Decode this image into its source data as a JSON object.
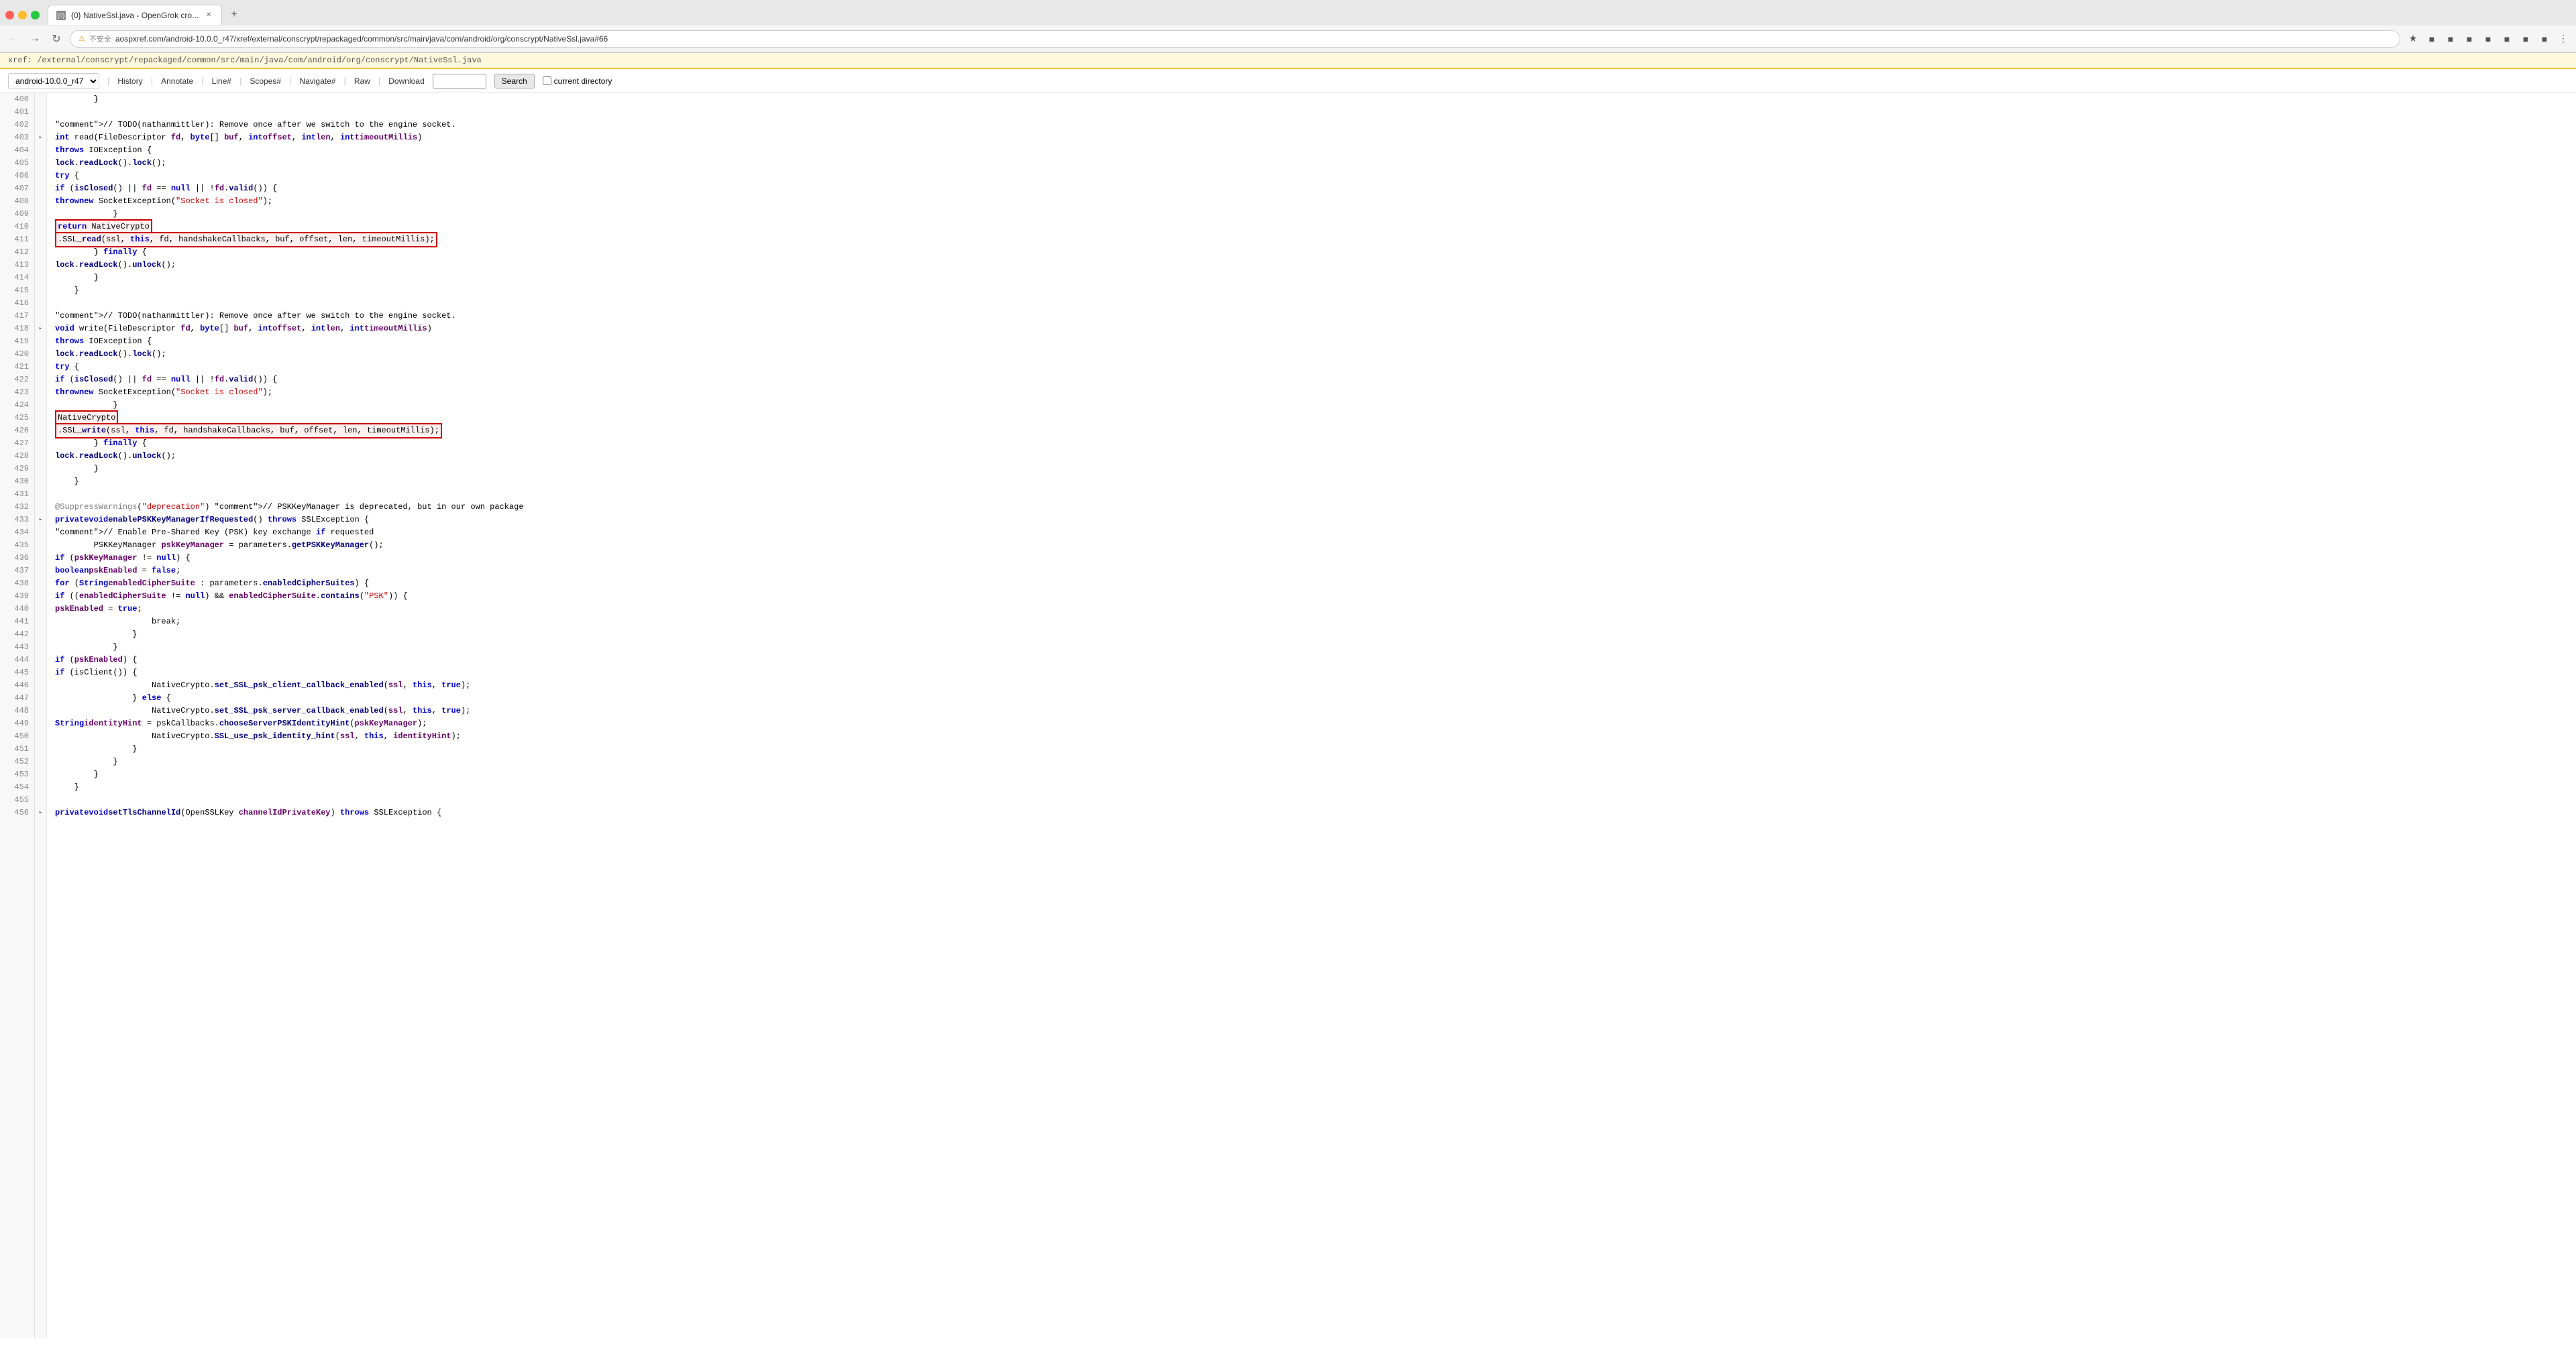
{
  "browser": {
    "tab_title": "{0} NativeSsl.java - OpenGrok cro...",
    "url": "aospxref.com/android-10.0.0_r47/xref/external/conscrypt/repackaged/common/src/main/java/com/android/org/conscrypt/NativeSsl.java#66",
    "full_url_prefix": "aospxref.com/android-10.0.0_r47/xref/external/conscrypt/repackaged/common/src/main/java/com/android/org/conscrypt/NativeSsl.java#66"
  },
  "breadcrumb": "xref: /external/conscrypt/repackaged/common/src/main/java/com/android/org/conscrypt/NativeSsl.java",
  "toolbar": {
    "version": "android-10.0.0_r47",
    "links": [
      "History",
      "Annotate",
      "Line#",
      "Scopes#",
      "Navigate#",
      "Raw",
      "Download"
    ],
    "search_placeholder": "",
    "search_btn": "Search",
    "checkbox_label": "current directory"
  },
  "code": {
    "lines": [
      {
        "num": "400",
        "fold": "",
        "content": "        }"
      },
      {
        "num": "401",
        "fold": "",
        "content": ""
      },
      {
        "num": "402",
        "fold": "",
        "content": "        // TODO(nathanmittler): Remove once after we switch to the engine socket."
      },
      {
        "num": "403",
        "fold": "▸",
        "content": "    int read(FileDescriptor fd, byte[] buf, int offset, int len, int timeoutMillis)"
      },
      {
        "num": "404",
        "fold": "",
        "content": "            throws IOException {"
      },
      {
        "num": "405",
        "fold": "",
        "content": "        lock.readLock().lock();"
      },
      {
        "num": "406",
        "fold": "",
        "content": "        try {"
      },
      {
        "num": "407",
        "fold": "",
        "content": "            if (isClosed() || fd == null || !fd.valid()) {"
      },
      {
        "num": "408",
        "fold": "",
        "content": "                throw new SocketException(\"Socket is closed\");"
      },
      {
        "num": "409",
        "fold": "",
        "content": "            }"
      },
      {
        "num": "410",
        "fold": "",
        "content": "            return NativeCrypto",
        "highlight_start": true
      },
      {
        "num": "411",
        "fold": "",
        "content": "                    .SSL_read(ssl, this, fd, handshakeCallbacks, buf, offset, len, timeoutMillis);",
        "highlight_end": true
      },
      {
        "num": "412",
        "fold": "",
        "content": "        } finally {"
      },
      {
        "num": "413",
        "fold": "",
        "content": "            lock.readLock().unlock();"
      },
      {
        "num": "414",
        "fold": "",
        "content": "        }"
      },
      {
        "num": "415",
        "fold": "",
        "content": "    }"
      },
      {
        "num": "416",
        "fold": "",
        "content": ""
      },
      {
        "num": "417",
        "fold": "",
        "content": "        // TODO(nathanmittler): Remove once after we switch to the engine socket."
      },
      {
        "num": "418",
        "fold": "▸",
        "content": "    void write(FileDescriptor fd, byte[] buf, int offset, int len, int timeoutMillis)"
      },
      {
        "num": "419",
        "fold": "",
        "content": "            throws IOException {"
      },
      {
        "num": "420",
        "fold": "",
        "content": "        lock.readLock().lock();"
      },
      {
        "num": "421",
        "fold": "",
        "content": "        try {"
      },
      {
        "num": "422",
        "fold": "",
        "content": "            if (isClosed() || fd == null || !fd.valid()) {"
      },
      {
        "num": "423",
        "fold": "",
        "content": "                throw new SocketException(\"Socket is closed\");"
      },
      {
        "num": "424",
        "fold": "",
        "content": "            }"
      },
      {
        "num": "425",
        "fold": "",
        "content": "            NativeCrypto",
        "highlight_start2": true
      },
      {
        "num": "426",
        "fold": "",
        "content": "                    .SSL_write(ssl, this, fd, handshakeCallbacks, buf, offset, len, timeoutMillis);",
        "highlight_end2": true
      },
      {
        "num": "427",
        "fold": "",
        "content": "        } finally {"
      },
      {
        "num": "428",
        "fold": "",
        "content": "            lock.readLock().unlock();"
      },
      {
        "num": "429",
        "fold": "",
        "content": "        }"
      },
      {
        "num": "430",
        "fold": "",
        "content": "    }"
      },
      {
        "num": "431",
        "fold": "",
        "content": ""
      },
      {
        "num": "432",
        "fold": "",
        "content": "    @SuppressWarnings(\"deprecation\") // PSKKeyManager is deprecated, but in our own package"
      },
      {
        "num": "433",
        "fold": "▸",
        "content": "    private void enablePSKKeyManagerIfRequested() throws SSLException {"
      },
      {
        "num": "434",
        "fold": "",
        "content": "        // Enable Pre-Shared Key (PSK) key exchange if requested"
      },
      {
        "num": "435",
        "fold": "",
        "content": "        PSKKeyManager pskKeyManager = parameters.getPSKKeyManager();"
      },
      {
        "num": "436",
        "fold": "",
        "content": "        if (pskKeyManager != null) {"
      },
      {
        "num": "437",
        "fold": "",
        "content": "            boolean pskEnabled = false;"
      },
      {
        "num": "438",
        "fold": "",
        "content": "            for (String enabledCipherSuite : parameters.enabledCipherSuites) {"
      },
      {
        "num": "439",
        "fold": "",
        "content": "                if ((enabledCipherSuite != null) && enabledCipherSuite.contains(\"PSK\")) {"
      },
      {
        "num": "440",
        "fold": "",
        "content": "                    pskEnabled = true;"
      },
      {
        "num": "441",
        "fold": "",
        "content": "                    break;"
      },
      {
        "num": "442",
        "fold": "",
        "content": "                }"
      },
      {
        "num": "443",
        "fold": "",
        "content": "            }"
      },
      {
        "num": "444",
        "fold": "",
        "content": "            if (pskEnabled) {"
      },
      {
        "num": "445",
        "fold": "",
        "content": "                if (isClient()) {"
      },
      {
        "num": "446",
        "fold": "",
        "content": "                    NativeCrypto.set_SSL_psk_client_callback_enabled(ssl, this, true);"
      },
      {
        "num": "447",
        "fold": "",
        "content": "                } else {"
      },
      {
        "num": "448",
        "fold": "",
        "content": "                    NativeCrypto.set_SSL_psk_server_callback_enabled(ssl, this, true);"
      },
      {
        "num": "449",
        "fold": "",
        "content": "                    String identityHint = pskCallbacks.chooseServerPSKIdentityHint(pskKeyManager);"
      },
      {
        "num": "450",
        "fold": "",
        "content": "                    NativeCrypto.SSL_use_psk_identity_hint(ssl, this, identityHint);"
      },
      {
        "num": "451",
        "fold": "",
        "content": "                }"
      },
      {
        "num": "452",
        "fold": "",
        "content": "            }"
      },
      {
        "num": "453",
        "fold": "",
        "content": "        }"
      },
      {
        "num": "454",
        "fold": "",
        "content": "    }"
      },
      {
        "num": "455",
        "fold": "",
        "content": ""
      },
      {
        "num": "456",
        "fold": "▸",
        "content": "    private void setTlsChannelId(OpenSSLKey channelIdPrivateKey) throws SSLException {"
      }
    ]
  }
}
